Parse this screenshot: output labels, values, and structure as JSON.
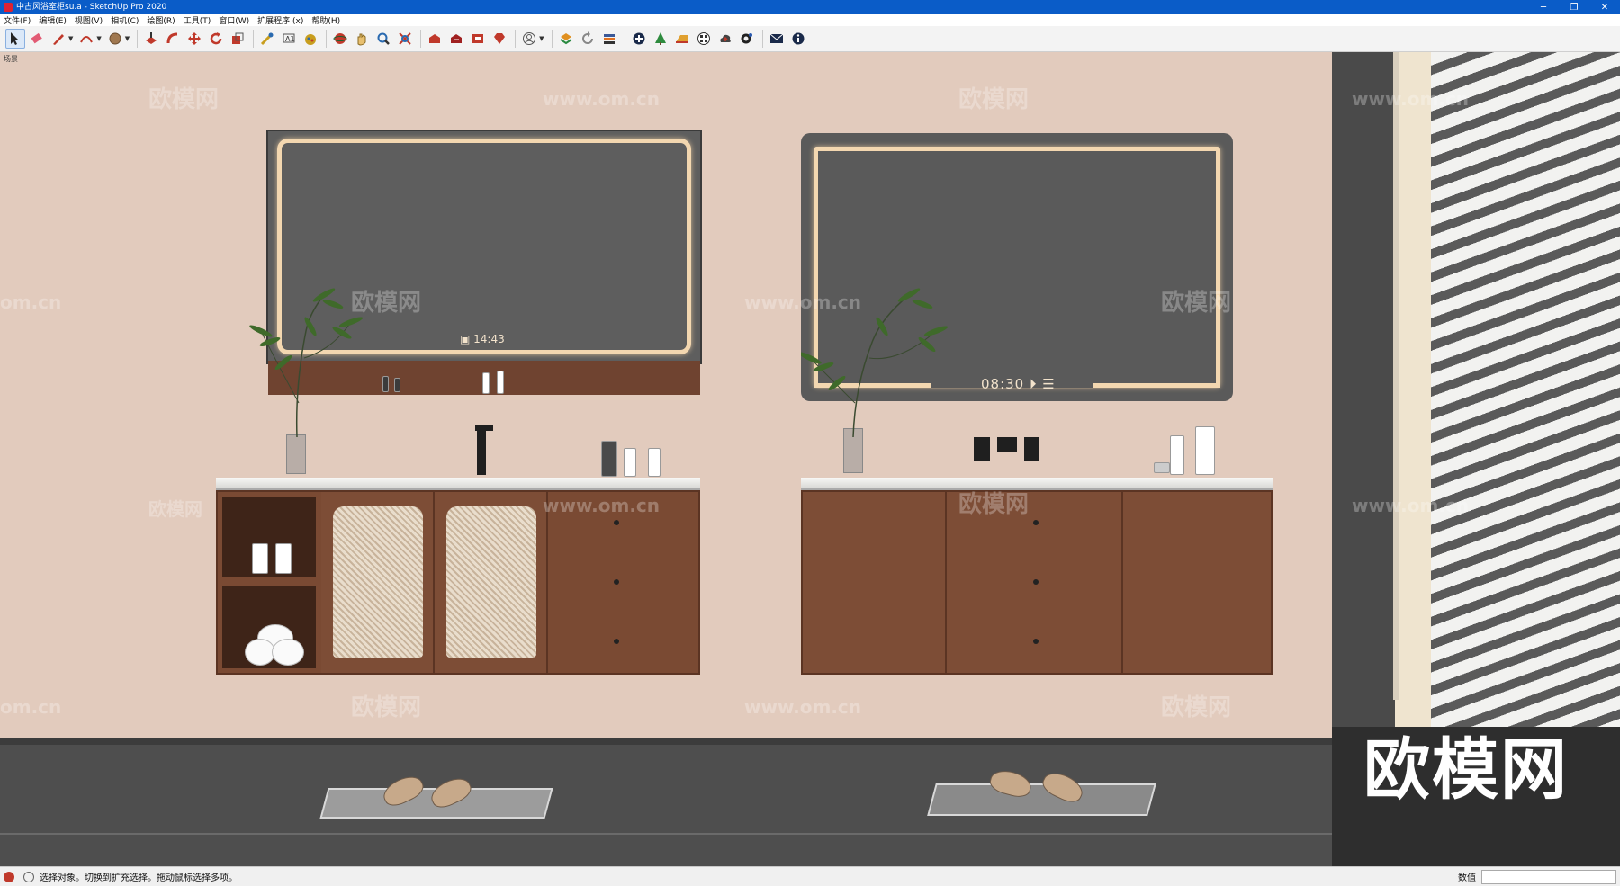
{
  "window": {
    "title": "中古风浴室柜su.a - SketchUp Pro 2020",
    "controls": {
      "minimize": "─",
      "restore": "❐",
      "close": "✕"
    }
  },
  "menu": {
    "items": [
      "文件(F)",
      "编辑(E)",
      "视图(V)",
      "相机(C)",
      "绘图(R)",
      "工具(T)",
      "窗口(W)",
      "扩展程序 (x)",
      "帮助(H)"
    ]
  },
  "toolbar": {
    "tools": [
      {
        "icon": "select-arrow-icon",
        "color": "#222222"
      },
      {
        "icon": "eraser-icon",
        "color": "#e25b74"
      },
      {
        "icon": "pencil-line-icon",
        "color": "#c0392b"
      },
      {
        "icon": "arc-icon",
        "color": "#c0392b"
      },
      {
        "icon": "shape-circle-icon",
        "color": "#a07850"
      },
      {
        "icon": "push-pull-icon",
        "color": "#c0392b"
      },
      {
        "icon": "follow-me-icon",
        "color": "#c0392b"
      },
      {
        "icon": "move-icon",
        "color": "#c0392b"
      },
      {
        "icon": "rotate-icon",
        "color": "#c0392b"
      },
      {
        "icon": "scale-icon",
        "color": "#c0392b"
      },
      {
        "icon": "tape-measure-icon",
        "color": "#c89e1e"
      },
      {
        "icon": "text-tool-icon",
        "color": "#555555"
      },
      {
        "icon": "paint-bucket-icon",
        "color": "#c89e1e"
      },
      {
        "icon": "orbit-icon",
        "color": "#c0392b"
      },
      {
        "icon": "pan-hand-icon",
        "color": "#c89e1e"
      },
      {
        "icon": "zoom-icon",
        "color": "#2a6ab0"
      },
      {
        "icon": "zoom-extents-icon",
        "color": "#c0392b"
      },
      {
        "icon": "warehouse-icon",
        "color": "#c0392b"
      },
      {
        "icon": "share-model-icon",
        "color": "#c0392b"
      },
      {
        "icon": "extension-warehouse-icon",
        "color": "#c0392b"
      },
      {
        "icon": "ruby-icon",
        "color": "#c0392b"
      },
      {
        "icon": "account-icon",
        "color": "#555555"
      },
      {
        "icon": "layer-out-icon",
        "color": "#e09020"
      },
      {
        "icon": "refresh-icon",
        "color": "#888888"
      },
      {
        "icon": "tags-stack-icon",
        "color": "#3b5998"
      },
      {
        "icon": "add-circle-icon",
        "color": "#1a2a4a"
      },
      {
        "icon": "tree-icon",
        "color": "#2e8b3e"
      },
      {
        "icon": "section-plane-icon",
        "color": "#e0a030"
      },
      {
        "icon": "checker-icon",
        "color": "#333333"
      },
      {
        "icon": "cloud-upload-icon",
        "color": "#444444"
      },
      {
        "icon": "settings-gear-icon",
        "color": "#2a5ab0"
      },
      {
        "icon": "mail-icon",
        "color": "#1a2a4a"
      },
      {
        "icon": "info-icon",
        "color": "#1a2a4a"
      }
    ]
  },
  "scene": {
    "label": "场景",
    "mirror_left_time": "14:43",
    "mirror_right_time": "08:30",
    "watermarks": [
      "欧模网",
      "www.om.cn",
      "om.cn"
    ],
    "brand_logo": "欧模网"
  },
  "status": {
    "hint": "选择对象。切换到扩充选择。拖动鼠标选择多项。",
    "measure_label": "数值",
    "measure_value": ""
  }
}
